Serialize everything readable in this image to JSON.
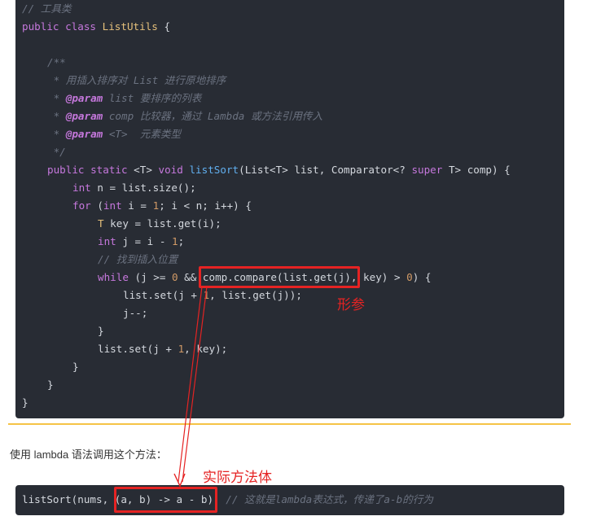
{
  "code_lines": [
    "// 工具类",
    "public class ListUtils {",
    "/**",
    " * 用插入排序对 List 进行原地排序",
    "@param",
    "list 要排序的列表",
    "comp 比较器，通过 Lambda 或方法引用传入",
    "<T>  元素类型",
    " */",
    "listSort",
    "int n = list.size();",
    "for (int i = 1; i < n; i++) {",
    "T key = list.get(i);",
    "int j = i - 1;",
    "// 找到插入位置",
    "while (j >= 0 && comp.compare(list.get(j), key) > 0) {",
    "list.set(j + 1, list.get(j));",
    "j--;",
    "}",
    "list.set(j + 1, key);",
    "}",
    "}",
    "}"
  ],
  "code2": {
    "call": "listSort(nums, (a, b) -> a - b);",
    "comment": "// 这就是lambda表达式，传递了a-b的行为"
  },
  "prose": {
    "text": "使用 lambda 语法调用这个方法："
  },
  "annotations": {
    "formal_param": "形参",
    "actual_body": "实际方法体"
  },
  "colors": {
    "code_bg": "#282c34",
    "highlight": "#e52323",
    "divider": "#f5c346"
  }
}
